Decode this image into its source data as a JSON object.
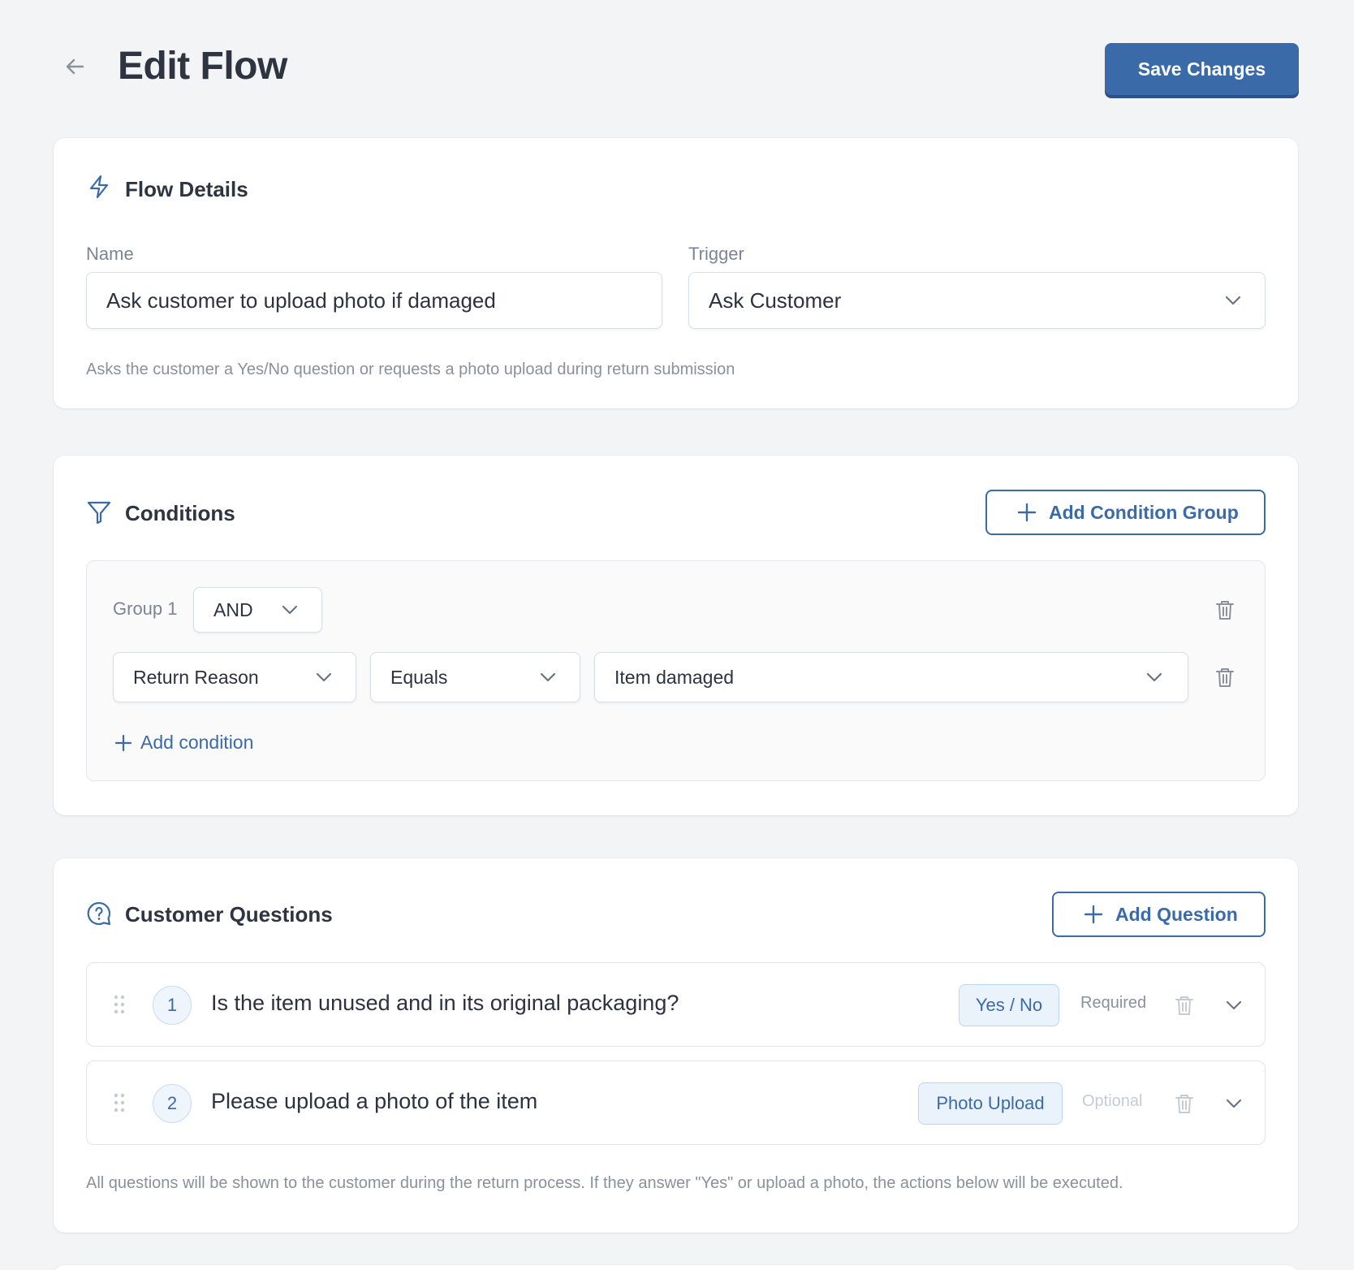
{
  "header": {
    "title": "Edit Flow",
    "save_label": "Save Changes"
  },
  "flow_details": {
    "title": "Flow Details",
    "name_label": "Name",
    "name_value": "Ask customer to upload photo if damaged",
    "trigger_label": "Trigger",
    "trigger_value": "Ask Customer",
    "helper": "Asks the customer a Yes/No question or requests a photo upload during return submission"
  },
  "conditions": {
    "title": "Conditions",
    "add_group_label": "Add Condition Group",
    "group": {
      "label": "Group 1",
      "operator": "AND",
      "condition": {
        "field": "Return Reason",
        "comparator": "Equals",
        "value": "Item damaged"
      },
      "add_condition_label": "Add condition"
    }
  },
  "questions": {
    "title": "Customer Questions",
    "add_label": "Add Question",
    "items": [
      {
        "number": "1",
        "text": "Is the item unused and in its original packaging?",
        "type": "Yes / No",
        "requirement": "Required"
      },
      {
        "number": "2",
        "text": "Please upload a photo of the item",
        "type": "Photo Upload",
        "requirement": "Optional"
      }
    ],
    "footer_note": "All questions will be shown to the customer during the return process. If they answer \"Yes\" or upload a photo, the actions below will be executed."
  },
  "colors": {
    "accent": "#3b6aa8",
    "background": "#f3f4f6",
    "badge_bg": "#eaf3fc"
  },
  "icons": {
    "back": "arrow-left-icon",
    "flow_details": "lightning-icon",
    "conditions": "filter-icon",
    "questions": "question-bubble-icon",
    "trash": "trash-icon",
    "chevron": "chevron-down-icon",
    "plus": "plus-icon",
    "drag": "drag-handle-icon"
  }
}
